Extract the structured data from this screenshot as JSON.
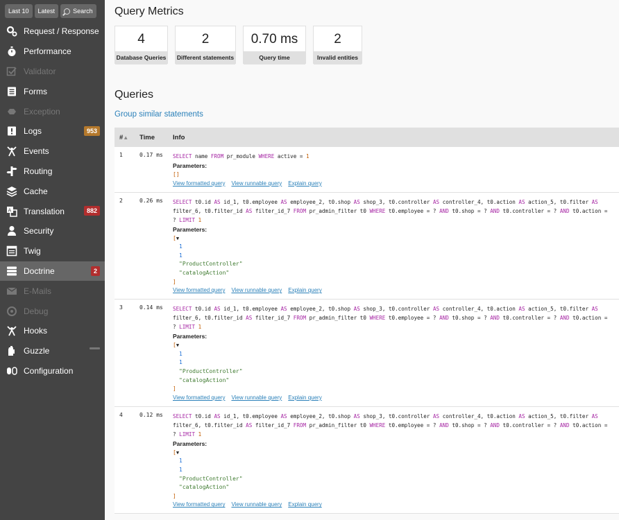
{
  "toolbar": {
    "last10": "Last 10",
    "latest": "Latest",
    "search": "Search"
  },
  "nav": [
    {
      "label": "Request / Response",
      "icon": "request-icon",
      "state": "normal",
      "badge": ""
    },
    {
      "label": "Performance",
      "icon": "timer-icon",
      "state": "normal",
      "badge": ""
    },
    {
      "label": "Validator",
      "icon": "validator-icon",
      "state": "disabled",
      "badge": ""
    },
    {
      "label": "Forms",
      "icon": "forms-icon",
      "state": "normal",
      "badge": ""
    },
    {
      "label": "Exception",
      "icon": "exception-icon",
      "state": "disabled",
      "badge": ""
    },
    {
      "label": "Logs",
      "icon": "logs-icon",
      "state": "normal",
      "badge": "953",
      "badge_color": "#b5792c"
    },
    {
      "label": "Events",
      "icon": "events-icon",
      "state": "normal",
      "badge": ""
    },
    {
      "label": "Routing",
      "icon": "routing-icon",
      "state": "normal",
      "badge": ""
    },
    {
      "label": "Cache",
      "icon": "cache-icon",
      "state": "normal",
      "badge": ""
    },
    {
      "label": "Translation",
      "icon": "translation-icon",
      "state": "normal",
      "badge": "882",
      "badge_color": "#b22e2e"
    },
    {
      "label": "Security",
      "icon": "security-icon",
      "state": "normal",
      "badge": ""
    },
    {
      "label": "Twig",
      "icon": "twig-icon",
      "state": "normal",
      "badge": ""
    },
    {
      "label": "Doctrine",
      "icon": "doctrine-icon",
      "state": "active",
      "badge": "2",
      "badge_color": "#b22e2e"
    },
    {
      "label": "E-Mails",
      "icon": "mail-icon",
      "state": "disabled",
      "badge": ""
    },
    {
      "label": "Debug",
      "icon": "debug-icon",
      "state": "disabled",
      "badge": ""
    },
    {
      "label": "Hooks",
      "icon": "hooks-icon",
      "state": "normal",
      "badge": ""
    },
    {
      "label": "Guzzle",
      "icon": "guzzle-icon",
      "state": "normal",
      "badge": ""
    },
    {
      "label": "Configuration",
      "icon": "configuration-icon",
      "state": "normal",
      "badge": ""
    }
  ],
  "metrics": {
    "title": "Query Metrics",
    "items": [
      {
        "value": "4",
        "label": "Database Queries"
      },
      {
        "value": "2",
        "label": "Different statements"
      },
      {
        "value": "0.70 ms",
        "label": "Query time"
      },
      {
        "value": "2",
        "label": "Invalid entities"
      }
    ]
  },
  "queries": {
    "title": "Queries",
    "group_link": "Group similar statements",
    "columns": {
      "num": "#",
      "time": "Time",
      "info": "Info"
    },
    "params_label": "Parameters:",
    "links": [
      "View formatted query",
      "View runnable query",
      "Explain query"
    ],
    "rows": [
      {
        "num": "1",
        "time": "0.17 ms",
        "sql": "SELECT name FROM pr_module WHERE active = 1",
        "params": "[]"
      },
      {
        "num": "2",
        "time": "0.26 ms",
        "sql": "SELECT t0.id AS id_1, t0.employee AS employee_2, t0.shop AS shop_3, t0.controller AS controller_4, t0.action AS action_5, t0.filter AS filter_6, t0.filter_id AS filter_id_7 FROM pr_admin_filter t0 WHERE t0.employee = ? AND t0.shop = ? AND t0.controller = ? AND t0.action = ? LIMIT 1",
        "param_values": [
          "1",
          "1",
          "\"ProductController\"",
          "\"catalogAction\""
        ]
      },
      {
        "num": "3",
        "time": "0.14 ms",
        "sql": "SELECT t0.id AS id_1, t0.employee AS employee_2, t0.shop AS shop_3, t0.controller AS controller_4, t0.action AS action_5, t0.filter AS filter_6, t0.filter_id AS filter_id_7 FROM pr_admin_filter t0 WHERE t0.employee = ? AND t0.shop = ? AND t0.controller = ? AND t0.action = ? LIMIT 1",
        "param_values": [
          "1",
          "1",
          "\"ProductController\"",
          "\"catalogAction\""
        ]
      },
      {
        "num": "4",
        "time": "0.12 ms",
        "sql": "SELECT t0.id AS id_1, t0.employee AS employee_2, t0.shop AS shop_3, t0.controller AS controller_4, t0.action AS action_5, t0.filter AS filter_6, t0.filter_id AS filter_id_7 FROM pr_admin_filter t0 WHERE t0.employee = ? AND t0.shop = ? AND t0.controller = ? AND t0.action = ? LIMIT 1",
        "param_values": [
          "1",
          "1",
          "\"ProductController\"",
          "\"catalogAction\""
        ]
      }
    ]
  }
}
